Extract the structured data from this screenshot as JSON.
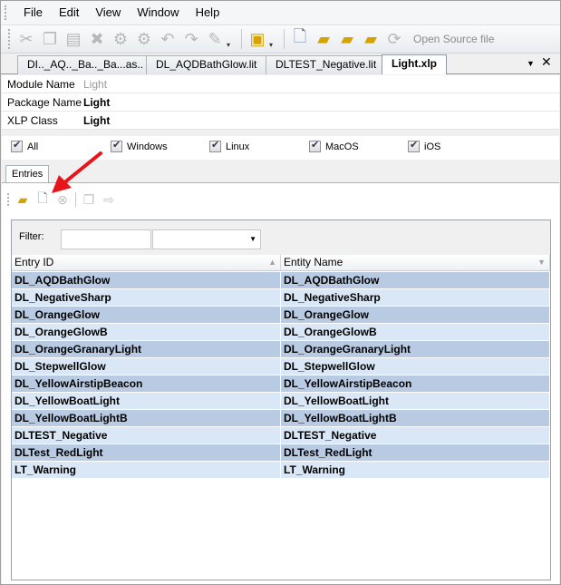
{
  "menu": {
    "items": [
      "File",
      "Edit",
      "View",
      "Window",
      "Help"
    ]
  },
  "toolbar": {
    "open_source_label": "Open Source file"
  },
  "tabs": [
    {
      "label": "DI.._AQ.._Ba.._Ba...as.."
    },
    {
      "label": "DL_AQDBathGlow.lit"
    },
    {
      "label": "DLTEST_Negative.lit"
    },
    {
      "label": "Light.xlp"
    }
  ],
  "properties": [
    {
      "label": "Module Name",
      "value": "Light",
      "muted": true
    },
    {
      "label": "Package Name",
      "value": "Light",
      "muted": false
    },
    {
      "label": "XLP Class",
      "value": "Light",
      "muted": false
    }
  ],
  "platforms": [
    {
      "label": "All",
      "checked": true
    },
    {
      "label": "Windows",
      "checked": true
    },
    {
      "label": "Linux",
      "checked": true
    },
    {
      "label": "MacOS",
      "checked": true
    },
    {
      "label": "iOS",
      "checked": true
    }
  ],
  "entries": {
    "tab_label": "Entries",
    "filter_label": "Filter:",
    "filter_value": "",
    "columns": [
      "Entry ID",
      "Entity Name"
    ],
    "rows": [
      [
        "DL_AQDBathGlow",
        "DL_AQDBathGlow"
      ],
      [
        "DL_NegativeSharp",
        "DL_NegativeSharp"
      ],
      [
        "DL_OrangeGlow",
        "DL_OrangeGlow"
      ],
      [
        "DL_OrangeGlowB",
        "DL_OrangeGlowB"
      ],
      [
        "DL_OrangeGranaryLight",
        "DL_OrangeGranaryLight"
      ],
      [
        "DL_StepwellGlow",
        "DL_StepwellGlow"
      ],
      [
        "DL_YellowAirstipBeacon",
        "DL_YellowAirstipBeacon"
      ],
      [
        "DL_YellowBoatLight",
        "DL_YellowBoatLight"
      ],
      [
        "DL_YellowBoatLightB",
        "DL_YellowBoatLightB"
      ],
      [
        "DLTEST_Negative",
        "DLTEST_Negative"
      ],
      [
        "DLTest_RedLight",
        "DLTest_RedLight"
      ],
      [
        "LT_Warning",
        "LT_Warning"
      ]
    ]
  },
  "colors": {
    "row_odd": "#b9cbe3",
    "row_even": "#dae7f6",
    "arrow": "#e8141c"
  },
  "icons": {
    "toolbar": [
      "cut-icon",
      "copy-icon",
      "paste-icon",
      "delete-icon",
      "settings-icon",
      "settings-alt-icon",
      "undo-icon",
      "redo-icon",
      "tools-icon",
      "module-icon",
      "new-document-icon",
      "open-folder-icon",
      "folder-open-icon",
      "folder-edit-icon",
      "refresh-icon"
    ],
    "entries_toolbar": [
      "open-folder-icon",
      "new-entry-icon",
      "remove-icon",
      "copy-entry-icon",
      "export-icon"
    ]
  }
}
